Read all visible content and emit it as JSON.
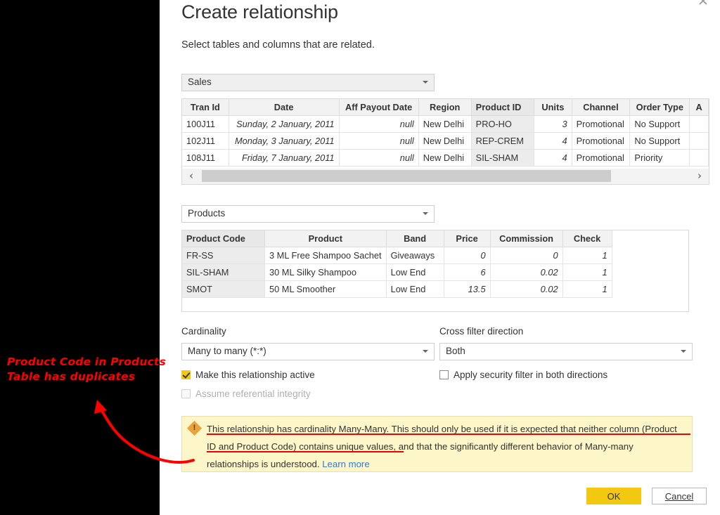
{
  "dialog": {
    "title": "Create relationship",
    "subtitle": "Select tables and columns that are related.",
    "close_icon": "✕"
  },
  "sales_section": {
    "selected_table": "Sales",
    "caret": "",
    "columns": [
      "Tran Id",
      "Date",
      "Aff Payout Date",
      "Region",
      "Product ID",
      "Units",
      "Channel",
      "Order Type",
      "A"
    ],
    "rows": [
      [
        "100J11",
        "Sunday, 2 January, 2011",
        "null",
        "New Delhi",
        "PRO-HO",
        "3",
        "Promotional",
        "No Support",
        ""
      ],
      [
        "102J11",
        "Monday, 3 January, 2011",
        "null",
        "New Delhi",
        "REP-CREM",
        "4",
        "Promotional",
        "No Support",
        ""
      ],
      [
        "108J11",
        "Friday, 7 January, 2011",
        "null",
        "New Delhi",
        "SIL-SHAM",
        "4",
        "Promotional",
        "Priority",
        ""
      ]
    ],
    "scroll_left": "‹",
    "scroll_right": "›"
  },
  "products_section": {
    "selected_table": "Products",
    "columns": [
      "Product Code",
      "Product",
      "Band",
      "Price",
      "Commission",
      "Check"
    ],
    "rows": [
      [
        "FR-SS",
        "3 ML Free Shampoo Sachet",
        "Giveaways",
        "0",
        "0",
        "1"
      ],
      [
        "SIL-SHAM",
        "30 ML Silky Shampoo",
        "Low End",
        "6",
        "0.02",
        "1"
      ],
      [
        "SMOT",
        "50 ML Smoother",
        "Low End",
        "13.5",
        "0.02",
        "1"
      ]
    ]
  },
  "options": {
    "cardinality_label": "Cardinality",
    "cardinality_value": "Many to many (*:*)",
    "cross_filter_label": "Cross filter direction",
    "cross_filter_value": "Both",
    "make_active_label": "Make this relationship active",
    "assume_ref_label": "Assume referential integrity",
    "apply_security_label": "Apply security filter in both directions"
  },
  "warning": {
    "text": "This relationship has cardinality Many-Many. This should only be used if it is expected that neither column (Product ID and Product Code) contains unique values, and that the significantly different behavior of Many-many relationships is understood.",
    "link": "Learn more",
    "icon": "warning-diamond-icon",
    "background": "#fdf6c8",
    "icon_color": "#e8a33d"
  },
  "footer": {
    "ok_label": "OK",
    "cancel_label": "Cancel",
    "ok_color": "#f2c811"
  },
  "annotation": {
    "line1": "Product Code in Products",
    "line2": "Table has duplicates",
    "color": "#ff0000"
  }
}
